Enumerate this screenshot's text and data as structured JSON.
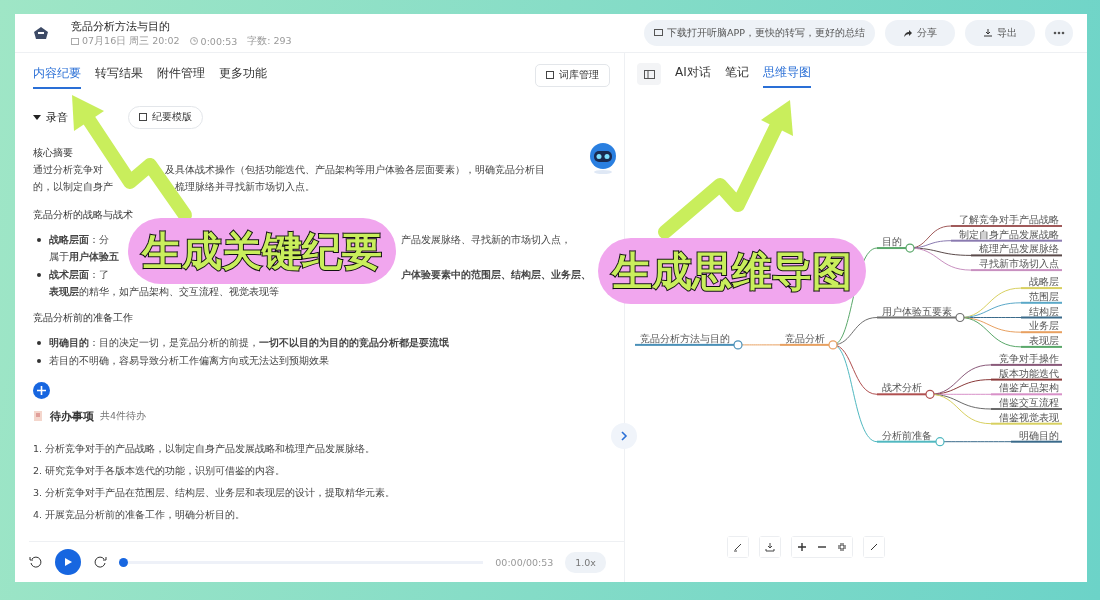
{
  "header": {
    "title": "竞品分析方法与目的",
    "date": "07月16日 周三 20:02",
    "duration": "0:00:53",
    "word_count": "字数: 293",
    "promo": "下载打开听脑APP，更快的转写，更好的总结",
    "share": "分享",
    "export": "导出"
  },
  "left_tabs": [
    {
      "label": "内容纪要",
      "selected": true
    },
    {
      "label": "转写结果",
      "selected": false
    },
    {
      "label": "附件管理",
      "selected": false
    },
    {
      "label": "更多功能",
      "selected": false
    }
  ],
  "glossary_button": "词库管理",
  "recording": {
    "label": "录音",
    "expanded": true,
    "template_button": "纪要模版"
  },
  "sections": [
    {
      "heading": "核心摘要",
      "lines": [
        [
          "通过分析竞争对",
          "及具体战术操作（包括功能迭代、产品架构等用户体验各层面要素），明确竞品分析目"
        ],
        [
          "的，以制定自身产",
          "梳理脉络并寻找新市场切入点。"
        ]
      ]
    },
    {
      "heading": "竞品分析的战略与战术",
      "bullets": [
        {
          "lines": [
            [
              "**战略层面**：分",
              "产品发展脉络、寻找新的市场切入点，"
            ],
            [
              "属于**用户体验五**"
            ]
          ]
        },
        {
          "lines": [
            [
              "**战术层面**：了",
              "**户体验要素中的范围层、结构层、业务层、**"
            ],
            [
              "**表现层**的精华，如产品架构、交互流程、视觉表现等"
            ]
          ]
        }
      ]
    },
    {
      "heading": "竞品分析前的准备工作",
      "bullets": [
        {
          "lines": [
            [
              "**明确目的**：目的决定一切，是竞品分析的前提，**一切不以目的为目的的竞品分析都是耍流氓**"
            ]
          ]
        },
        {
          "lines": [
            [
              "若目的不明确，容易导致分析工作偏离方向或无法达到预期效果"
            ]
          ]
        }
      ]
    }
  ],
  "todo": {
    "title": "待办事项",
    "count": "共4件待办",
    "items": [
      "1. 分析竞争对手的产品战略，以制定自身产品发展战略和梳理产品发展脉络。",
      "2. 研究竞争对手各版本迭代的功能，识别可借鉴的内容。",
      "3. 分析竞争对手产品在范围层、结构层、业务层和表现层的设计，提取精华元素。",
      "4. 开展竞品分析前的准备工作，明确分析目的。"
    ]
  },
  "player": {
    "time": "00:00/00:53",
    "speed": "1.0x",
    "level": 0.0
  },
  "right_tabs": [
    {
      "label": "AI对话",
      "selected": false
    },
    {
      "label": "笔记",
      "selected": false
    },
    {
      "label": "思维导图",
      "selected": true
    }
  ],
  "mindmap": {
    "label": "竞品分析方法与目的",
    "color": "#4a90b8",
    "children": [
      {
        "label": "竞品分析",
        "color": "#e8a060",
        "children": [
          {
            "label": "目的",
            "color": "#5aa86a",
            "children": [
              {
                "label": "了解竞争对手产品战略",
                "color": "#a05a5a"
              },
              {
                "label": "制定自身产品发展战略",
                "color": "#8a7ab0"
              },
              {
                "label": "梳理产品发展脉络",
                "color": "#5a4a4a"
              },
              {
                "label": "寻找新市场切入点",
                "color": "#c890c0"
              }
            ]
          },
          {
            "label": "用户体验五要素",
            "color": "#707070",
            "children": [
              {
                "label": "战略层",
                "color": "#d8d060"
              },
              {
                "label": "范围层",
                "color": "#5aa8c8"
              },
              {
                "label": "结构层",
                "color": "#3a6a8a"
              },
              {
                "label": "业务层",
                "color": "#e8a060"
              },
              {
                "label": "表现层",
                "color": "#5aa86a"
              }
            ]
          },
          {
            "label": "战术分析",
            "color": "#b05050",
            "children": [
              {
                "label": "竞争对手操作",
                "color": "#8a5a7a"
              },
              {
                "label": "版本功能迭代",
                "color": "#8a3a3a"
              },
              {
                "label": "借鉴产品架构",
                "color": "#d890c8"
              },
              {
                "label": "借鉴交互流程",
                "color": "#6a6a6a"
              },
              {
                "label": "借鉴视觉表现",
                "color": "#d8d060"
              }
            ]
          },
          {
            "label": "分析前准备",
            "color": "#50b8c0",
            "children": [
              {
                "label": "明确目的",
                "color": "#3a6a8a"
              }
            ]
          }
        ]
      }
    ]
  },
  "annotations": [
    "生成关键纪要",
    "生成思维导图"
  ]
}
